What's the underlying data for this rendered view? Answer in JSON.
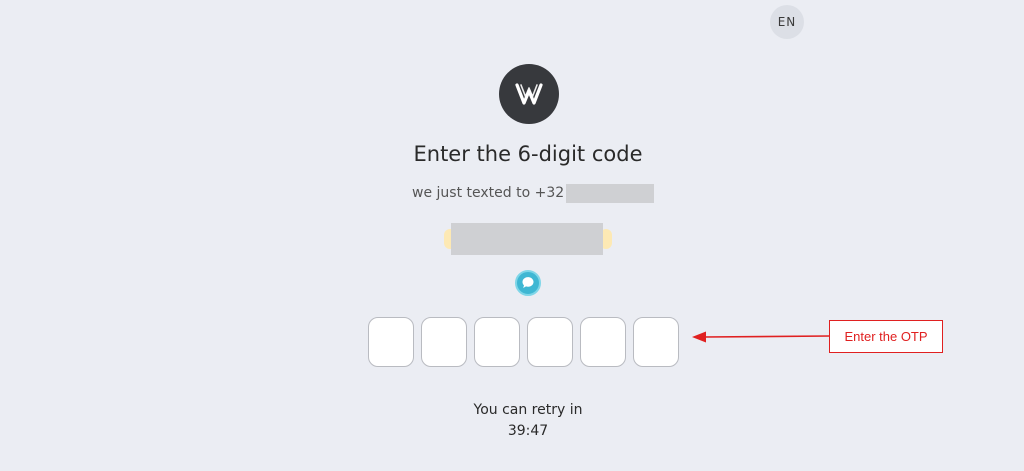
{
  "header": {
    "language_label": "EN"
  },
  "logo": {
    "icon": "w-logo-icon",
    "background": "#37393d"
  },
  "verification": {
    "title": "Enter the 6-digit code",
    "subtitle_prefix": "we just texted to +32"
  },
  "otp": {
    "digits": [
      "",
      "",
      "",
      "",
      "",
      ""
    ]
  },
  "annotation": {
    "label": "Enter the OTP",
    "color": "#e02020"
  },
  "retry": {
    "label": "You can retry in",
    "countdown": "39:47"
  }
}
